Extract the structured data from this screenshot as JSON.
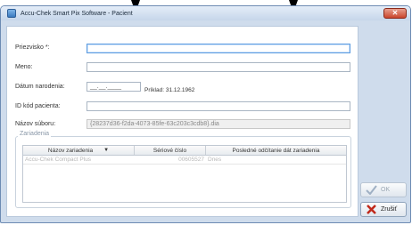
{
  "window": {
    "title": "Accu-Chek Smart Pix Software - Pacient",
    "close_symbol": "✕"
  },
  "form": {
    "surname_label": "Priezvisko *:",
    "name_label": "Meno:",
    "dob_label": "Dátum narodenia:",
    "dob_value": "__.__.____",
    "dob_hint": "Príklad: 31.12.1962",
    "patient_id_label": "ID kód pacienta:",
    "filename_label": "Názov súboru:",
    "filename_value": "{28237d36-f2da-4073-85fe-63c203c3cdb8}.dia"
  },
  "devices": {
    "group_title": "Zariadenia",
    "columns": [
      "Názov zariadenia",
      "Sériové číslo",
      "Posledné odčítanie dát zariadenia"
    ],
    "rows": [
      {
        "name": "Accu-Chek Compact Plus",
        "serial": "00605527",
        "last_read": "Dnes"
      }
    ]
  },
  "buttons": {
    "ok": "OK",
    "cancel": "Zrušiť"
  },
  "colors": {
    "title_bar": "#c6d6ea",
    "frame": "#cfdcec",
    "focus_border": "#5b9be0"
  }
}
